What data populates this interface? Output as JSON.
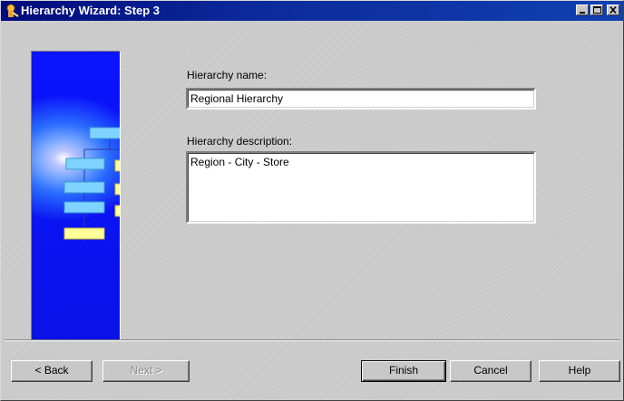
{
  "window": {
    "title": "Hierarchy Wizard: Step 3",
    "title_buttons": [
      "minimize-icon",
      "maximize-icon",
      "close-icon"
    ]
  },
  "form": {
    "name_label": "Hierarchy name:",
    "name_value": "Regional Hierarchy",
    "description_label": "Hierarchy description:",
    "description_value": "Region - City - Store"
  },
  "buttons": {
    "back": "< Back",
    "next": "Next >",
    "finish": "Finish",
    "cancel": "Cancel",
    "help": "Help"
  },
  "colors": {
    "titlebar": "#000a7a",
    "banner_blue": "#0a14ff",
    "banner_box_cyan": "#7fd4ff",
    "banner_box_yellow": "#ffff99"
  }
}
